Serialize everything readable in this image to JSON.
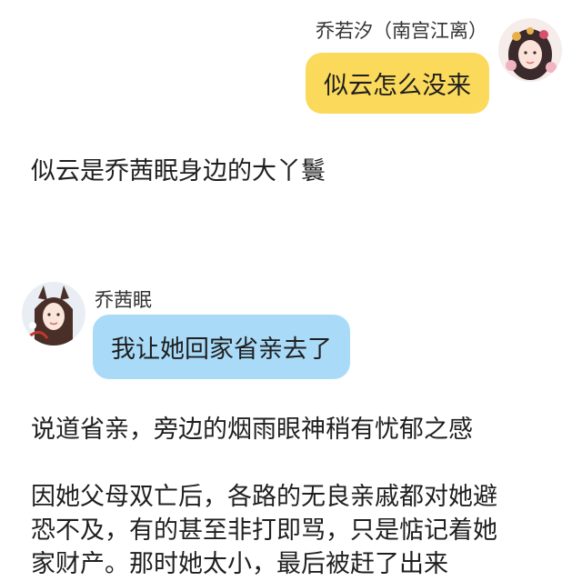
{
  "messages": [
    {
      "side": "right",
      "name": "乔若汐（南宫江离）",
      "text": "似云怎么没来",
      "bubble_color": "#fbd95b",
      "avatar_icon": "girl-portrait-avatar"
    },
    {
      "side": "left",
      "name": "乔茜眠",
      "text": "我让她回家省亲去了",
      "bubble_color": "#a9dbf9",
      "avatar_icon": "girl-portrait-avatar"
    }
  ],
  "narration": {
    "line1": "似云是乔茜眠身边的大丫鬟",
    "line2": "说道省亲，旁边的烟雨眼神稍有忧郁之感",
    "paragraph": [
      "因她父母双亡后，各路的无良亲戚都对她避",
      "恐不及，有的甚至非打即骂，只是惦记着她",
      "家财产。那时她太小，最后被赶了出来"
    ]
  }
}
